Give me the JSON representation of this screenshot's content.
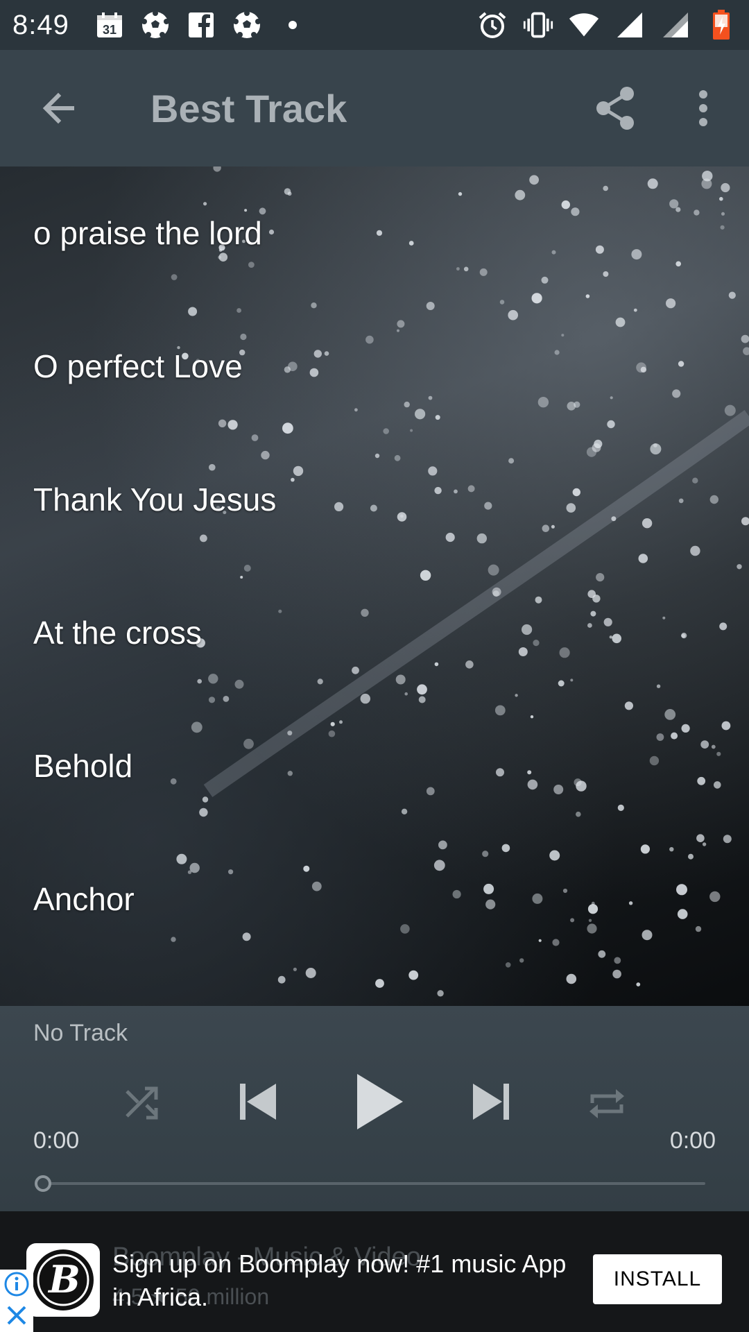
{
  "status_bar": {
    "time": "8:49",
    "left_icons": [
      "calendar-icon",
      "soccer-ball-icon",
      "facebook-icon",
      "soccer-ball-icon",
      "dot-icon"
    ],
    "right_icons": [
      "alarm-icon",
      "vibrate-icon",
      "wifi-icon",
      "signal-icon",
      "signal-icon",
      "battery-charging-icon"
    ],
    "calendar_day": "31"
  },
  "app_bar": {
    "title": "Best Track",
    "back_icon": "arrow-back-icon",
    "share_icon": "share-icon",
    "more_icon": "more-vert-icon"
  },
  "tracks": [
    {
      "label": "o praise the lord"
    },
    {
      "label": "O perfect Love"
    },
    {
      "label": "Thank You Jesus"
    },
    {
      "label": "At the cross"
    },
    {
      "label": "Behold"
    },
    {
      "label": "Anchor"
    }
  ],
  "player": {
    "now_playing": "No Track",
    "time_elapsed": "0:00",
    "time_total": "0:00",
    "progress": 0,
    "controls": [
      "shuffle-icon",
      "skip-previous-icon",
      "play-icon",
      "skip-next-icon",
      "repeat-icon"
    ]
  },
  "ad": {
    "ghost_title": "Boomplay - Music & Video",
    "ghost_meta": "4.5 ★ 50 million",
    "text": "Sign up on Boomplay now! #1 music App in Africa.",
    "install_label": "INSTALL",
    "logo_letter": "B"
  },
  "colors": {
    "status_bar": "#2b353c",
    "app_bar": "#38444c",
    "player": "#38434a",
    "ad_background": "#151719",
    "ad_choices": "#1e88e5"
  }
}
